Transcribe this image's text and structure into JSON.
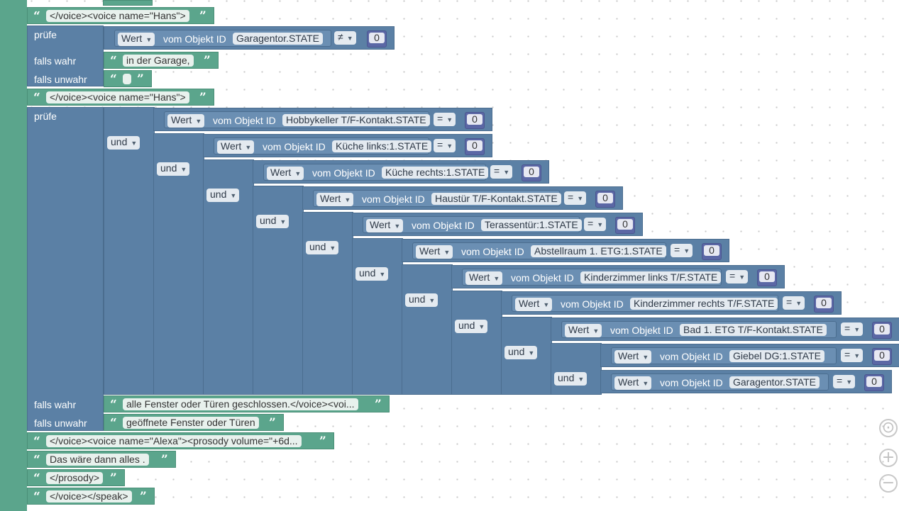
{
  "labels": {
    "falls_wahr": "falls wahr",
    "falls_unwahr": "falls unwahr",
    "pruefe": "prüfe",
    "und": "und",
    "wert": "Wert",
    "vom_objekt_id": "vom Objekt ID"
  },
  "texts": {
    "voice_hans": "</voice><voice name=\"Hans\">",
    "in_der_garage": "in der Garage,",
    "alle_geschlossen": "alle Fenster oder Türen geschlossen.</voice><voi...",
    "geoeffnete": "geöffnete Fenster oder Türen",
    "voice_alexa": "</voice><voice name=\"Alexa\"><prosody volume=\"+6d...",
    "das_waere": "Das wäre dann alles .",
    "prosody_end": "</prosody>",
    "speak_end": "</voice></speak>"
  },
  "ops": {
    "ne": "≠",
    "eq": "="
  },
  "value": "0",
  "conditions": [
    "Hobbykeller T/F-Kontakt.STATE",
    "Küche links:1.STATE",
    "Küche rechts:1.STATE",
    "Haustür T/F-Kontakt.STATE",
    "Terassentür:1.STATE",
    "Abstellraum 1. ETG:1.STATE",
    "Kinderzimmer links T/F.STATE",
    "Kinderzimmer rechts T/F.STATE",
    "Bad 1. ETG T/F-Kontakt.STATE",
    "Giebel DG:1.STATE",
    "Garagentor.STATE"
  ],
  "first_condition": "Garagentor.STATE",
  "controls": {
    "center": "⊙",
    "zoom_in": "+",
    "zoom_out": "−"
  },
  "colors": {
    "text_block": "#5ba58c",
    "logic_block": "#5b80a5",
    "number_block": "#5b67a5"
  }
}
